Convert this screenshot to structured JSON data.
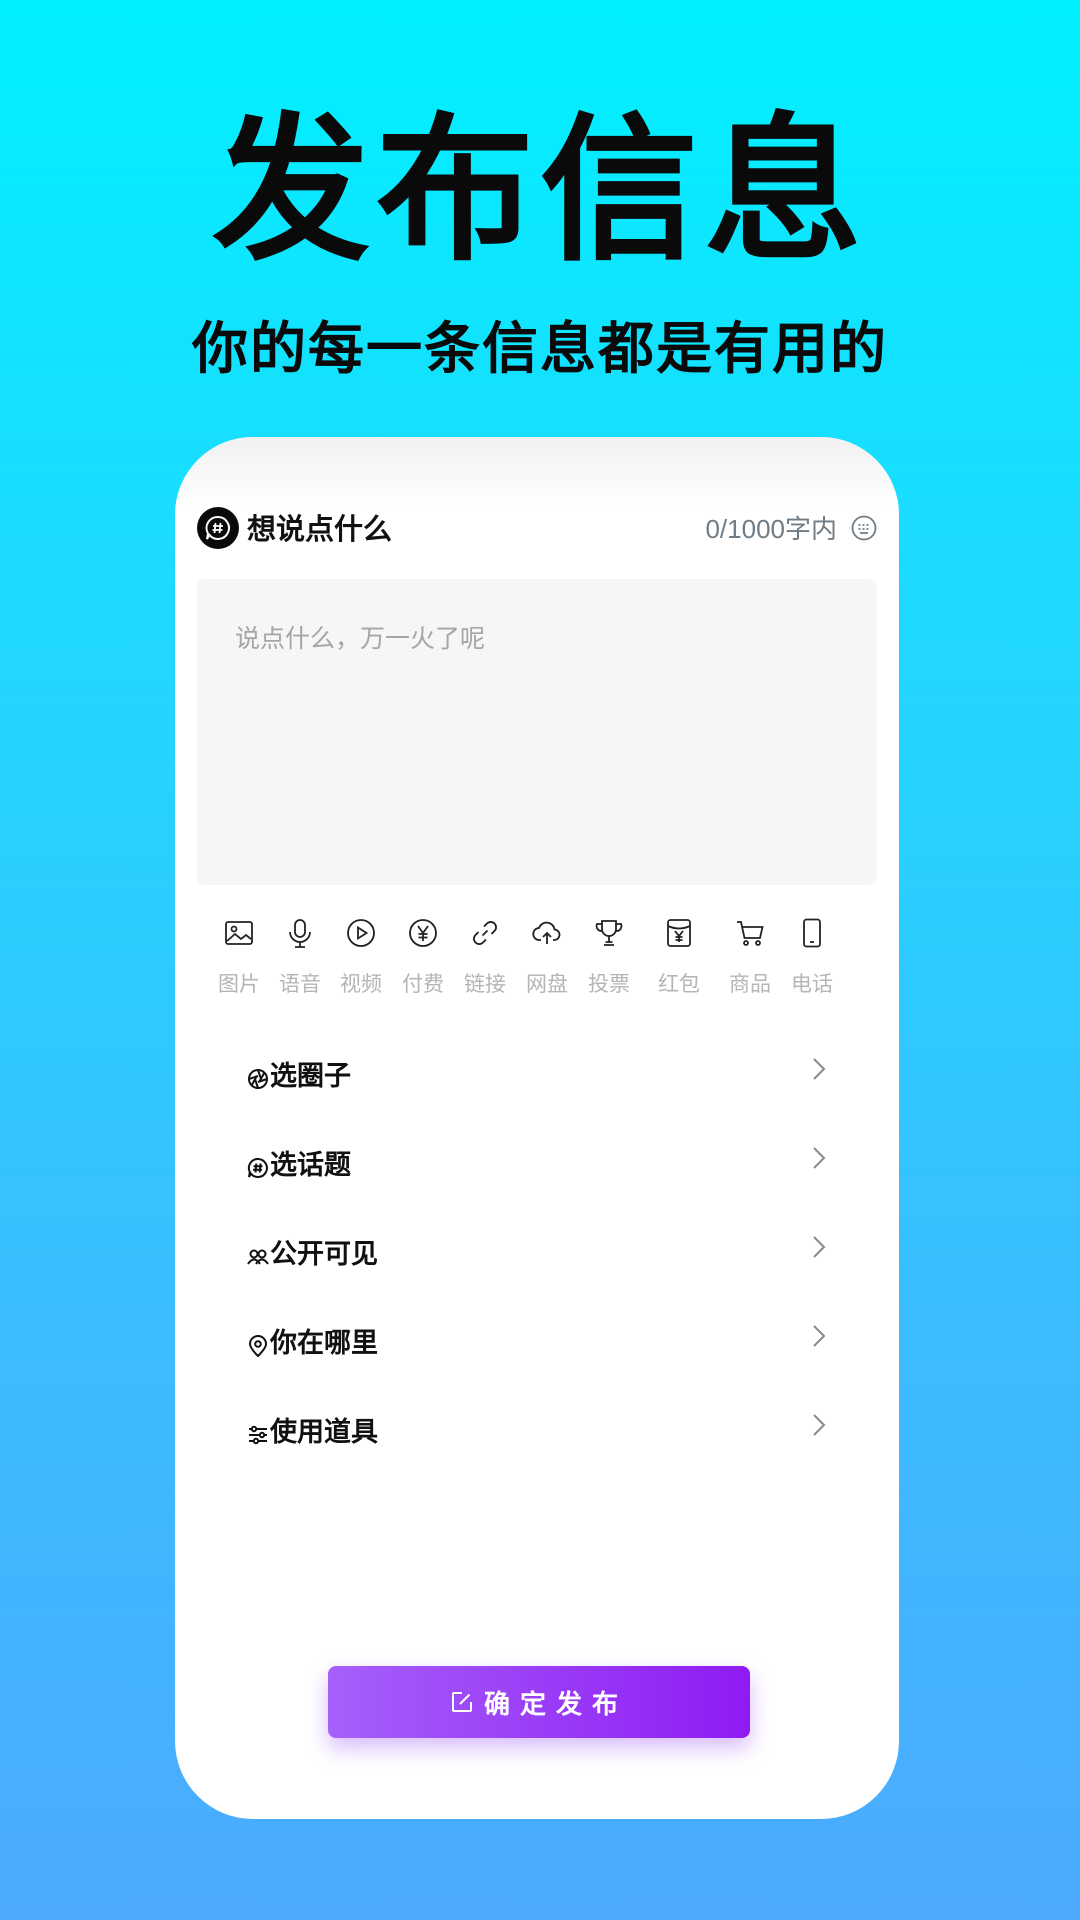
{
  "hero": {
    "title": "发布信息",
    "subtitle": "你的每一条信息都是有用的"
  },
  "compose": {
    "title": "想说点什么",
    "counter": "0/1000字内",
    "placeholder": "说点什么，万一火了呢",
    "topic_icon": "hashtag-chat-icon",
    "keyboard_icon": "keyboard-icon"
  },
  "tools": [
    {
      "label": "图片",
      "icon": "image-icon"
    },
    {
      "label": "语音",
      "icon": "microphone-icon"
    },
    {
      "label": "视频",
      "icon": "play-icon"
    },
    {
      "label": "付费",
      "icon": "yen-coin-icon"
    },
    {
      "label": "链接",
      "icon": "link-icon"
    },
    {
      "label": "网盘",
      "icon": "cloud-upload-icon"
    },
    {
      "label": "投票",
      "icon": "trophy-icon"
    },
    {
      "label": "红包",
      "icon": "red-packet-icon"
    },
    {
      "label": "商品",
      "icon": "cart-icon"
    },
    {
      "label": "电话",
      "icon": "phone-icon"
    }
  ],
  "options": [
    {
      "label": "选圈子",
      "icon": "circle-aperture-icon"
    },
    {
      "label": "选话题",
      "icon": "topic-icon"
    },
    {
      "label": "公开可见",
      "icon": "users-icon"
    },
    {
      "label": "你在哪里",
      "icon": "location-icon"
    },
    {
      "label": "使用道具",
      "icon": "sliders-icon"
    }
  ],
  "publish": {
    "label": "确定发布",
    "icon": "edit-icon"
  },
  "colors": {
    "background_top": "#00f0ff",
    "background_bottom": "#4caaff",
    "button_start": "#a660fb",
    "button_end": "#8f1bf3"
  }
}
